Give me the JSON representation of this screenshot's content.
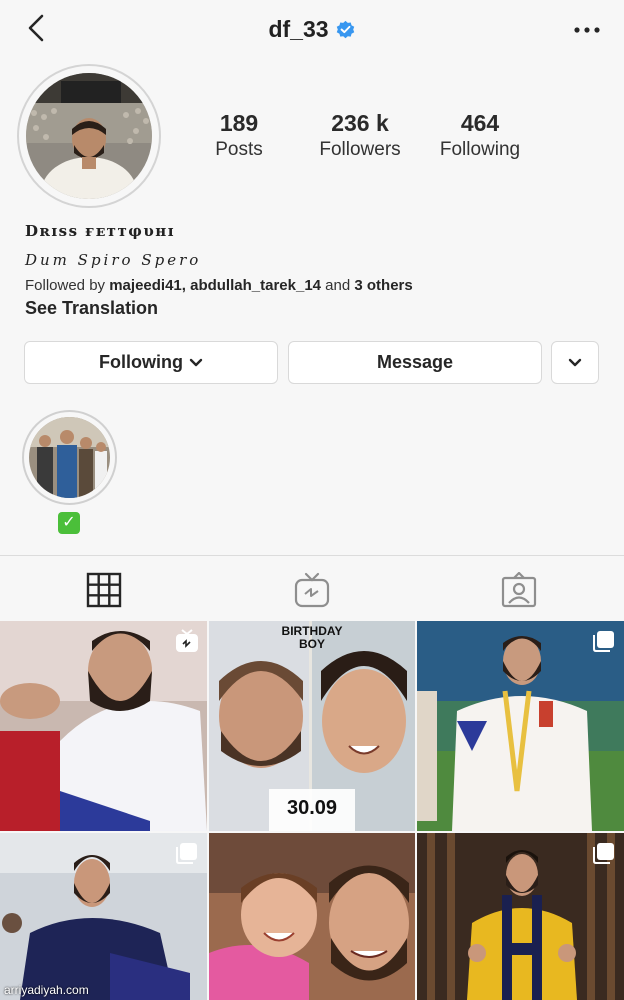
{
  "header": {
    "username": "df_33",
    "verified_icon": "verified-badge-icon",
    "back_icon": "chevron-left-icon",
    "more_icon": "more-dots-icon"
  },
  "stats": [
    {
      "value": "189",
      "label": "Posts"
    },
    {
      "value": "236 k",
      "label": "Followers"
    },
    {
      "value": "464",
      "label": "Following"
    }
  ],
  "profile": {
    "full_name": "Dʀɪss ғᴇᴛᴛφυʜɪ",
    "bio": "Dum Spiro Spero",
    "followed_by_prefix": "Followed by",
    "followed_by_users": "majeedi41, abdullah_tarek_14",
    "followed_by_and": "and",
    "followed_by_others": "3 others",
    "see_translation": "See Translation"
  },
  "buttons": {
    "following": "Following",
    "message": "Message"
  },
  "highlight": {
    "emoji": "✓"
  },
  "tabs": [
    "grid-icon",
    "igtv-icon",
    "tagged-icon"
  ],
  "posts": [
    {
      "type": "igtv"
    },
    {
      "type": "image",
      "caption_top": "BIRTHDAY BOY",
      "caption_bottom": "30.09"
    },
    {
      "type": "carousel"
    },
    {
      "type": "carousel"
    },
    {
      "type": "image"
    },
    {
      "type": "carousel"
    }
  ],
  "watermark": "arriyadiyah.com",
  "colors": {
    "verified": "#3897f0",
    "background": "#f7f7f7",
    "check": "#4bbf3a"
  }
}
